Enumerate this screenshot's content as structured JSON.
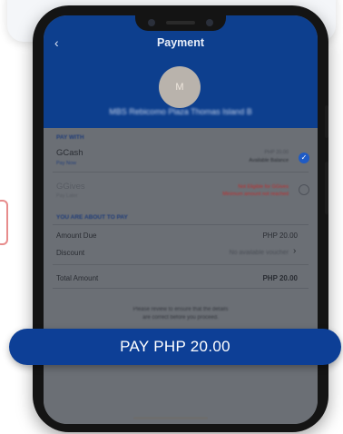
{
  "screen": {
    "back_icon": "chevron-left-icon",
    "title": "Payment",
    "avatar_initials": "M",
    "merchant_name": "MBS Rebicomo Plaza Thomas Island B"
  },
  "pay_with": {
    "label": "PAY WITH",
    "options": [
      {
        "name": "GCash",
        "sub": "Pay Now",
        "right_line1": "PHP 20.00",
        "right_line2": "Available Balance",
        "selected": true
      },
      {
        "name": "GGives",
        "sub": "Pay Later",
        "right_line1": "Not Eligible for GGives",
        "right_line2": "Minimum amount not reached",
        "selected": false
      }
    ]
  },
  "summary": {
    "label": "YOU ARE ABOUT TO PAY",
    "amount_due_label": "Amount Due",
    "amount_due_value": "PHP 20.00",
    "discount_label": "Discount",
    "discount_value": "No available voucher",
    "total_label": "Total Amount",
    "total_value": "PHP 20.00"
  },
  "note": {
    "line1": "Please review to ensure that the details",
    "line2": "are correct before you proceed."
  },
  "pay_button_label": "PAY PHP 20.00",
  "colors": {
    "primary": "#0d3f96",
    "header": "#0d3f8e",
    "screen_overlay": "#6b6f75",
    "warning": "#c22a2a"
  }
}
